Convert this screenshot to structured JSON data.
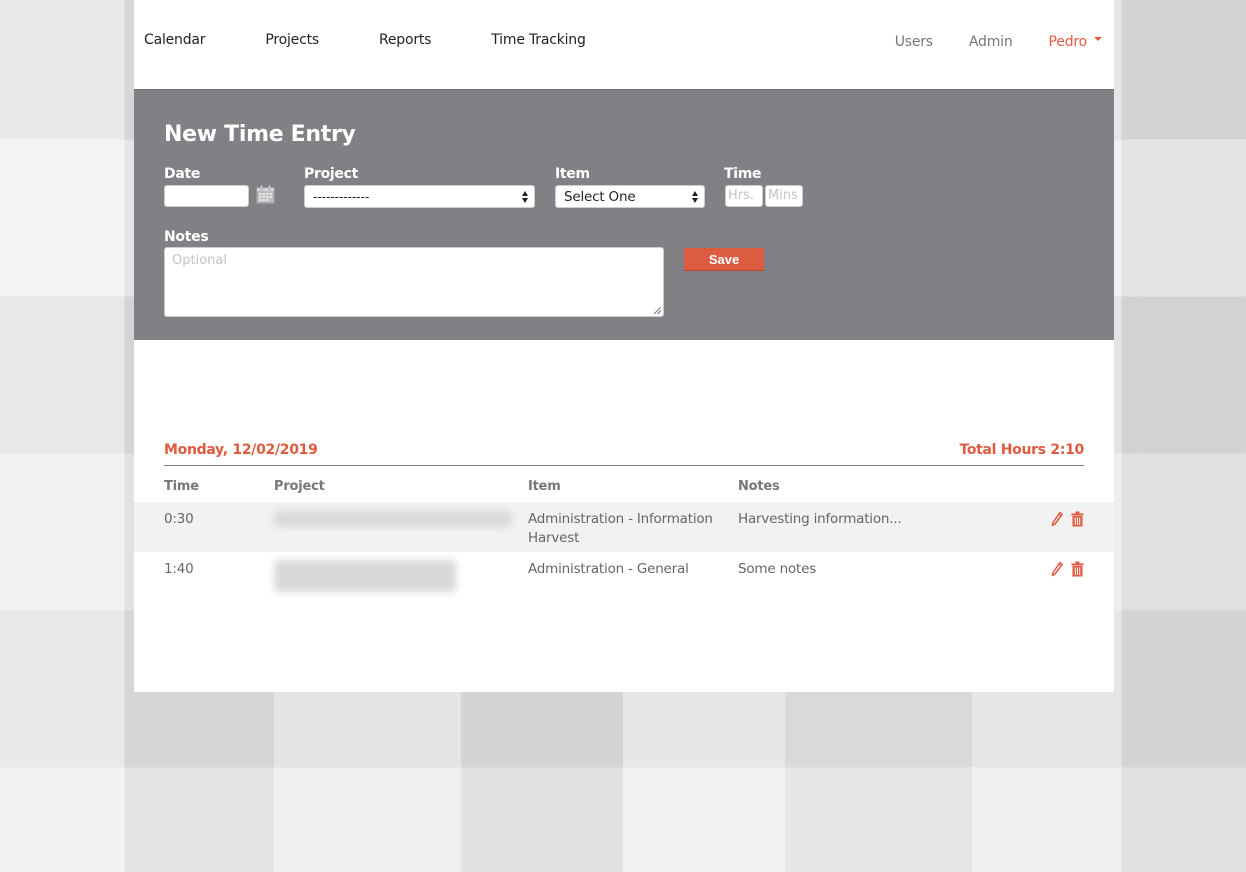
{
  "nav": {
    "left": [
      "Calendar",
      "Projects",
      "Reports",
      "Time Tracking"
    ],
    "right": [
      "Users",
      "Admin"
    ],
    "user": "Pedro"
  },
  "entry_form": {
    "title": "New Time Entry",
    "date_label": "Date",
    "date_value": "",
    "project_label": "Project",
    "project_selected": "-------------",
    "item_label": "Item",
    "item_selected": "Select One",
    "time_label": "Time",
    "hours_placeholder": "Hrs.",
    "mins_placeholder": "Mins",
    "notes_label": "Notes",
    "notes_placeholder": "Optional",
    "save_label": "Save"
  },
  "day": {
    "title": "Monday, 12/02/2019",
    "total": "Total Hours 2:10",
    "columns": [
      "Time",
      "Project",
      "Item",
      "Notes"
    ],
    "entries": [
      {
        "time": "0:30",
        "project": "[redacted]",
        "item": "Administration - Information Harvest",
        "notes": "Harvesting information..."
      },
      {
        "time": "1:40",
        "project": "[redacted]",
        "item": "Administration - General",
        "notes": "Some notes"
      }
    ]
  },
  "colors": {
    "accent": "#e05a40",
    "form_bg": "#818185",
    "row_alt": "#f2f2f2"
  },
  "icons": {
    "calendar": "calendar-icon",
    "edit": "pencil-icon",
    "delete": "trash-icon",
    "user_menu": "caret-down-icon"
  }
}
